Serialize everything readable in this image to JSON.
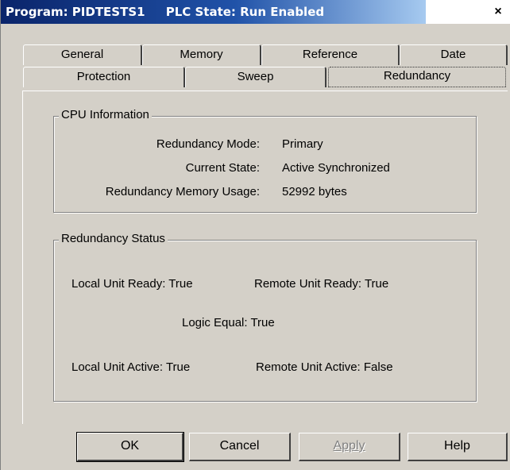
{
  "window": {
    "title": "Program: PIDTESTS1     PLC State: Run Enabled",
    "close_glyph": "×"
  },
  "tabs": {
    "row1": [
      "General",
      "Memory",
      "Reference",
      "Date"
    ],
    "row2": [
      "Protection",
      "Sweep",
      "Redundancy"
    ],
    "active": "Redundancy"
  },
  "cpu_info": {
    "title": "CPU Information",
    "redundancy_mode_label": "Redundancy Mode:",
    "redundancy_mode_value": "Primary",
    "current_state_label": "Current State:",
    "current_state_value": "Active Synchronized",
    "memory_usage_label": "Redundancy Memory Usage:",
    "memory_usage_value": "52992 bytes"
  },
  "status": {
    "title": "Redundancy Status",
    "local_ready": "Local Unit Ready:  True",
    "remote_ready": "Remote Unit Ready:  True",
    "logic_equal": "Logic Equal:  True",
    "local_active": "Local Unit Active:  True",
    "remote_active": "Remote Unit Active:  False"
  },
  "buttons": {
    "ok": "OK",
    "cancel": "Cancel",
    "apply": "Apply",
    "help": "Help"
  }
}
